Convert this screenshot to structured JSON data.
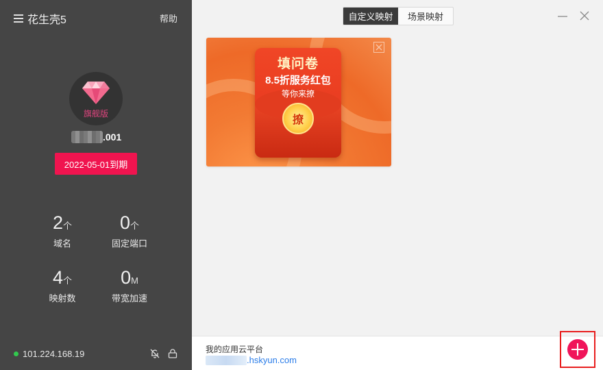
{
  "app": {
    "title": "花生壳5",
    "help": "帮助"
  },
  "account": {
    "badge": "旗舰版",
    "username_suffix": ".001",
    "expiry": "2022-05-01到期"
  },
  "stats": [
    {
      "value": "2",
      "unit": "个",
      "label": "域名"
    },
    {
      "value": "0",
      "unit": "个",
      "label": "固定端口"
    },
    {
      "value": "4",
      "unit": "个",
      "label": "映射数"
    },
    {
      "value": "0",
      "unit": "M",
      "label": "带宽加速"
    }
  ],
  "status": {
    "ip": "101.224.168.19",
    "color": "#32c94e"
  },
  "tabs": [
    {
      "label": "自定义映射",
      "active": true
    },
    {
      "label": "场景映射",
      "active": false
    }
  ],
  "banner": {
    "title": "填问卷",
    "line1": "8.5折服务红包",
    "line2": "等你来撩",
    "coin": "撩"
  },
  "footer": {
    "title": "我的应用云平台",
    "link_suffix": ".hskyun.com"
  },
  "colors": {
    "accent": "#f0145a",
    "sidebar": "#454545",
    "link": "#2b7de9"
  }
}
